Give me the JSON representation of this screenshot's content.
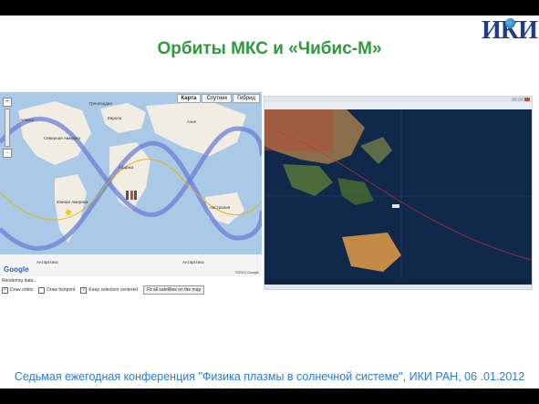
{
  "logo_text": "ИКИ",
  "title": "Орбиты МКС и «Чибис-М»",
  "left_map": {
    "tabs": [
      "Карта",
      "Спутник",
      "Гибрид"
    ],
    "active_tab": "Карта",
    "zoom_in": "+",
    "zoom_out": "−",
    "google_logo": "Google",
    "copyright": "©2012 Google",
    "labels": {
      "a1": "Аляска",
      "a2": "Северная Америка",
      "a3": "Европа",
      "a4": "Азия",
      "a5": "Африка",
      "a6": "Южная Америка",
      "a7": "Австралия",
      "a8": "Антарктика",
      "a9": "Антарктика",
      "a10": "Гренландия"
    }
  },
  "controls": {
    "status": "Rendering data...",
    "draw_orbits": "Draw orbits",
    "draw_footprint": "Draw footprint",
    "keep_selection": "Keep selection centered",
    "fit_button": "Fit all satellites on the map"
  },
  "footer": "Седьмая ежегодная конференция \"Физика плазмы в солнечной системе\", ИКИ РАН, 06 .01.2012"
}
